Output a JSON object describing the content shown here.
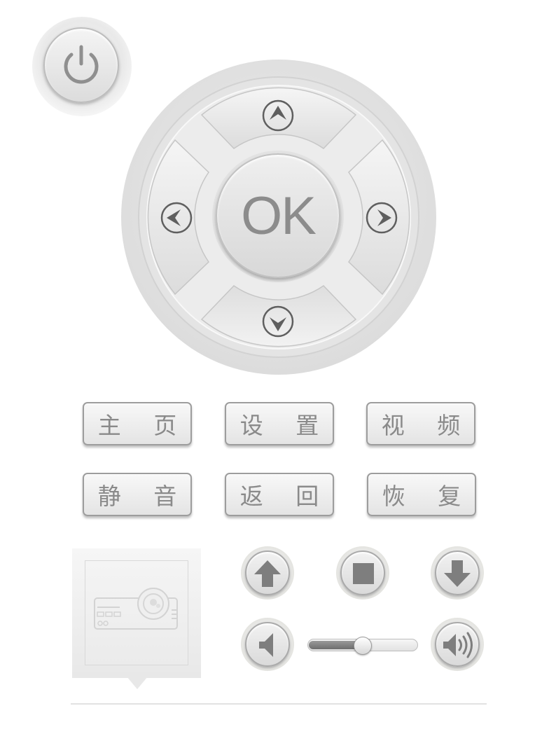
{
  "dpad": {
    "ok_label": "OK"
  },
  "menu": {
    "home": "主 页",
    "settings": "设 置",
    "video": "视 频",
    "mute": "静 音",
    "back": "返 回",
    "restore": "恢 复"
  },
  "media": {
    "volume_level": 0.5
  },
  "icons": {
    "power": "power-icon",
    "up": "chevron-up-icon",
    "down": "chevron-down-icon",
    "left": "chevron-left-icon",
    "right": "chevron-right-icon",
    "projector": "projector-icon",
    "arrow_up": "arrow-up-icon",
    "stop": "stop-icon",
    "arrow_down": "arrow-down-icon",
    "volume_down": "volume-down-icon",
    "volume_up": "volume-up-icon"
  },
  "colors": {
    "icon_gray": "#8a8a8a",
    "surface": "#eaeaea"
  }
}
